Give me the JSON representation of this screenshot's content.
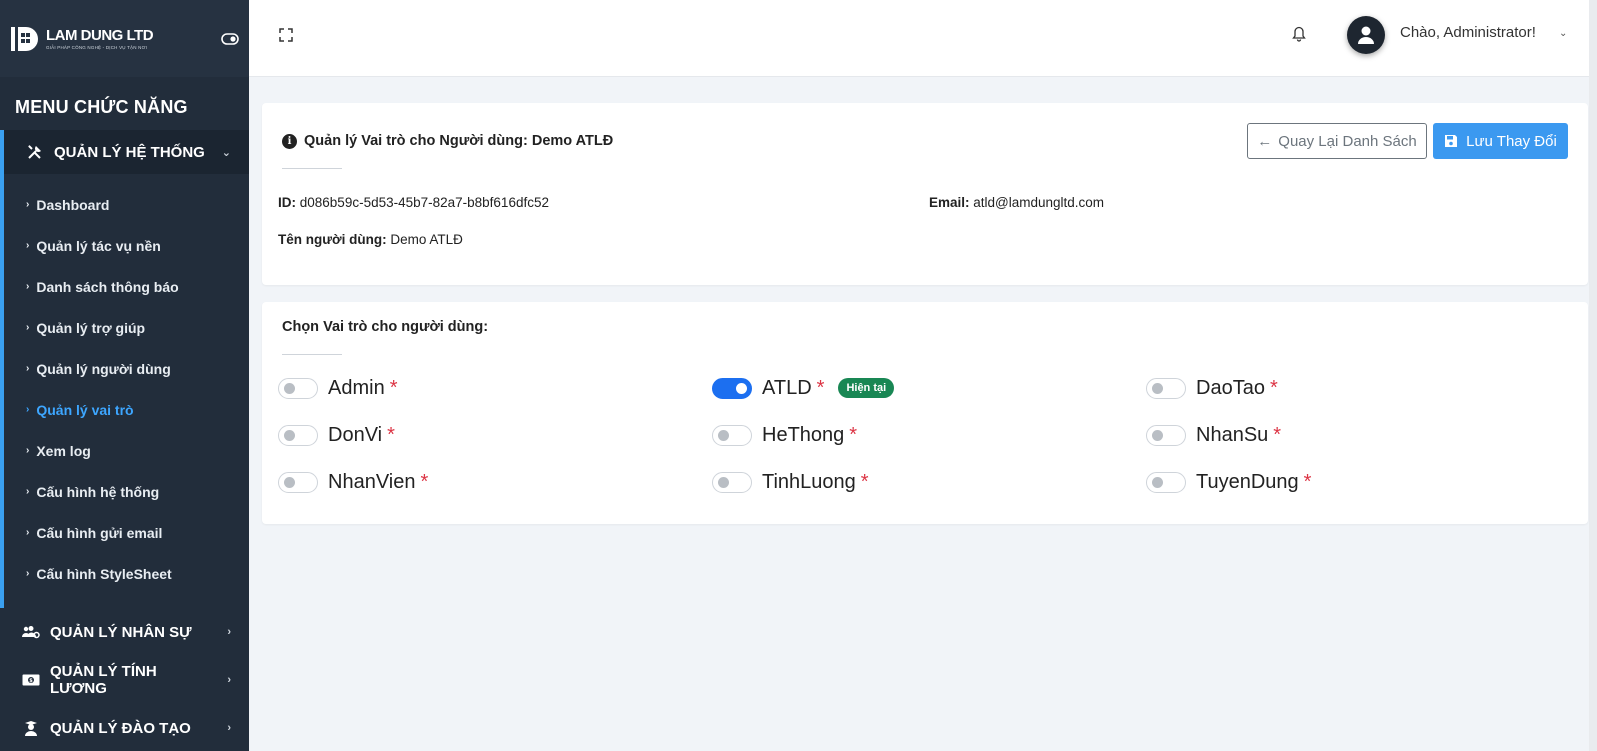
{
  "brand": {
    "name": "LAM DUNG LTD",
    "tagline": "GIẢI PHÁP CÔNG NGHỆ - DỊCH VỤ TẬN NƠI"
  },
  "sidebar": {
    "menu_title": "MENU CHỨC NĂNG",
    "open_group": {
      "label": "QUẢN LÝ HỆ THỐNG",
      "items": [
        {
          "label": "Dashboard"
        },
        {
          "label": "Quản lý tác vụ nền"
        },
        {
          "label": "Danh sách thông báo"
        },
        {
          "label": "Quản lý trợ giúp"
        },
        {
          "label": "Quản lý người dùng"
        },
        {
          "label": "Quản lý vai trò"
        },
        {
          "label": "Xem log"
        },
        {
          "label": "Cấu hình hệ thống"
        },
        {
          "label": "Cấu hình gửi email"
        },
        {
          "label": "Cấu hình StyleSheet"
        }
      ],
      "active_item": "Quản lý vai trò"
    },
    "groups": [
      {
        "label": "QUẢN LÝ NHÂN SỰ",
        "icon": "users-cog-icon"
      },
      {
        "label": "QUẢN LÝ TÍNH LƯƠNG",
        "icon": "money-bill-icon"
      },
      {
        "label": "QUẢN LÝ ĐÀO TẠO",
        "icon": "graduate-icon"
      }
    ]
  },
  "topbar": {
    "greeting": "Chào, Administrator!"
  },
  "user_card": {
    "title": "Quản lý Vai trò cho Người dùng: Demo ATLĐ",
    "back_label": "Quay Lại Danh Sách",
    "save_label": "Lưu Thay Đổi",
    "id_label": "ID:",
    "id_value": "d086b59c-5d53-45b7-82a7-b8bf616dfc52",
    "email_label": "Email:",
    "email_value": "atld@lamdungltd.com",
    "username_label": "Tên người dùng:",
    "username_value": "Demo ATLĐ"
  },
  "roles_card": {
    "title": "Chọn Vai trò cho người dùng:",
    "required_mark": "*",
    "current_badge": "Hiện tại",
    "roles": [
      {
        "name": "Admin",
        "checked": false
      },
      {
        "name": "ATLD",
        "checked": true,
        "current": true
      },
      {
        "name": "DaoTao",
        "checked": false
      },
      {
        "name": "DonVi",
        "checked": false
      },
      {
        "name": "HeThong",
        "checked": false
      },
      {
        "name": "NhanSu",
        "checked": false
      },
      {
        "name": "NhanVien",
        "checked": false
      },
      {
        "name": "TinhLuong",
        "checked": false
      },
      {
        "name": "TuyenDung",
        "checked": false
      }
    ]
  },
  "colors": {
    "sidebar_bg": "#222d3b",
    "accent": "#3b99f0",
    "switch_on": "#1c6ff0",
    "badge": "#198754",
    "required": "#dc3545"
  }
}
